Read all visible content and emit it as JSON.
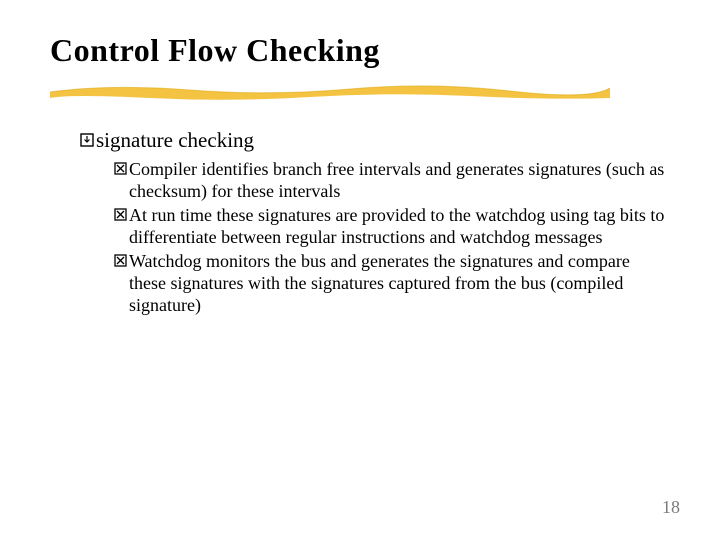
{
  "title": "Control Flow Checking",
  "bullet": {
    "label": "signature checking",
    "subs": [
      "Compiler identifies branch free intervals and generates signatures (such as checksum) for these intervals",
      "At run time these signatures are provided to the watchdog using tag bits to differentiate between regular instructions and watchdog messages",
      "Watchdog monitors the bus and generates the signatures and compare these signatures with the signatures captured from the bus (compiled signature)"
    ]
  },
  "page_number": "18"
}
